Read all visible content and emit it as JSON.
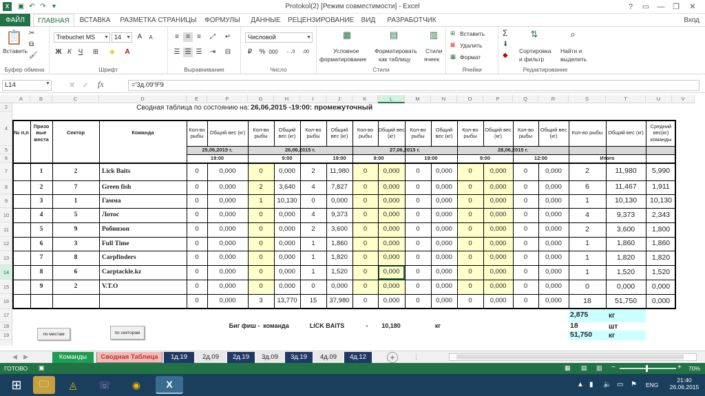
{
  "window": {
    "title": "Protokol(2) [Режим совместимости] - Excel",
    "user": "Вход"
  },
  "tabs": [
    "ФАЙЛ",
    "ГЛАВНАЯ",
    "ВСТАВКА",
    "РАЗМЕТКА СТРАНИЦЫ",
    "ФОРМУЛЫ",
    "ДАННЫЕ",
    "РЕЦЕНЗИРОВАНИЕ",
    "ВИД",
    "РАЗРАБОТЧИК"
  ],
  "ribbon": {
    "clipboard": {
      "label": "Буфер обмена",
      "paste": "Вставить"
    },
    "font": {
      "label": "Шрифт",
      "name": "Trebuchet MS",
      "size": "14",
      "bold": "Ж",
      "italic": "К",
      "underline": "Ч",
      "grow": "A",
      "shrink": "A"
    },
    "alignment": {
      "label": "Выравнивание"
    },
    "number": {
      "label": "Число",
      "format": "Числовой",
      "percent": "%",
      "thousands": "000",
      "inc_dec": "←,0",
      "dec_dec": ",00"
    },
    "styles": {
      "label": "Стили",
      "conditional": [
        "Условное",
        "форматирование"
      ],
      "table": [
        "Форматировать",
        "как таблицу"
      ],
      "cell": [
        "Стили",
        "ячеек"
      ]
    },
    "cells": {
      "label": "Ячейки",
      "insert": "Вставить",
      "delete": "Удалить",
      "format": "Формат"
    },
    "editing": {
      "label": "Редактирование",
      "sort": [
        "Сортировка",
        "и фильтр"
      ],
      "find": [
        "Найти и",
        "выделить"
      ]
    }
  },
  "formula_bar": {
    "name_box": "L14",
    "formula": "='3д.09'!F9"
  },
  "columns": [
    "A",
    "B",
    "C",
    "D",
    "E",
    "F",
    "G",
    "H",
    "I",
    "J",
    "K",
    "L",
    "M",
    "N",
    "O",
    "P",
    "Q",
    "R",
    "S",
    "T",
    "U",
    "V"
  ],
  "rows": [
    "2",
    "4",
    "5",
    "6",
    "7",
    "8",
    "9",
    "10",
    "11",
    "12",
    "13",
    "14",
    "15",
    "16",
    "17",
    "18",
    "19"
  ],
  "sheet": {
    "title_label": "Сводная таблица по состоянию на:",
    "title_value": "26,06,2015 -19:00: промежуточный",
    "hdr_num": "№ п,п",
    "hdr_place": "Призо вые места",
    "hdr_sector": "Сектор",
    "hdr_team": "Команда",
    "hdr_qty": "Кол-во рыбы",
    "hdr_weight": "Общий вес (кг)",
    "hdr_qty_total": "Кол-во рыбы",
    "hdr_weight_total": "Общий вес (кг)",
    "hdr_avg": "Средний вес(кг) команды",
    "dates": [
      "25,06,2015 г.",
      "26,06,2015 г.",
      "27,06,2015 г.",
      "28,06,2015 г."
    ],
    "times": [
      "19:00",
      "9:00",
      "19:00",
      "9:00",
      "19:00",
      "9:00",
      "12:00"
    ],
    "total_label": "Итого",
    "teams": [
      {
        "n": "1",
        "p": "2",
        "name": "Lick Baits",
        "v": [
          "0",
          "0,000",
          "0",
          "0,000",
          "2",
          "11,980",
          "0",
          "0,000",
          "0",
          "0,000",
          "0",
          "0,000",
          "0",
          "0,000"
        ],
        "tq": "2",
        "tw": "11,980",
        "avg": "5,990"
      },
      {
        "n": "2",
        "p": "7",
        "name": "Green fish",
        "v": [
          "0",
          "0,000",
          "2",
          "3,640",
          "4",
          "7,827",
          "0",
          "0,000",
          "0",
          "0,000",
          "0",
          "0,000",
          "0",
          "0,000"
        ],
        "tq": "6",
        "tw": "11,467",
        "avg": "1,911"
      },
      {
        "n": "3",
        "p": "1",
        "name": "Гамма",
        "v": [
          "0",
          "0,000",
          "1",
          "10,130",
          "0",
          "0,000",
          "0",
          "0,000",
          "0",
          "0,000",
          "0",
          "0,000",
          "0",
          "0,000"
        ],
        "tq": "1",
        "tw": "10,130",
        "avg": "10,130"
      },
      {
        "n": "4",
        "p": "5",
        "name": "Лотос",
        "v": [
          "0",
          "0,000",
          "0",
          "0,000",
          "4",
          "9,373",
          "0",
          "0,000",
          "0",
          "0,000",
          "0",
          "0,000",
          "0",
          "0,000"
        ],
        "tq": "4",
        "tw": "9,373",
        "avg": "2,343"
      },
      {
        "n": "5",
        "p": "9",
        "name": "Робинзон",
        "v": [
          "0",
          "0,000",
          "0",
          "0,000",
          "2",
          "3,600",
          "0",
          "0,000",
          "0",
          "0,000",
          "0",
          "0,000",
          "0",
          "0,000"
        ],
        "tq": "2",
        "tw": "3,600",
        "avg": "1,800"
      },
      {
        "n": "6",
        "p": "3",
        "name": "Full Time",
        "v": [
          "0",
          "0,000",
          "0",
          "0,000",
          "1",
          "1,860",
          "0",
          "0,000",
          "0",
          "0,000",
          "0",
          "0,000",
          "0",
          "0,000"
        ],
        "tq": "1",
        "tw": "1,860",
        "avg": "1,860"
      },
      {
        "n": "7",
        "p": "8",
        "name": "Carpfinders",
        "v": [
          "0",
          "0,000",
          "0",
          "0,000",
          "1",
          "1,820",
          "0",
          "0,000",
          "0",
          "0,000",
          "0",
          "0,000",
          "0",
          "0,000"
        ],
        "tq": "1",
        "tw": "1,820",
        "avg": "1,820"
      },
      {
        "n": "8",
        "p": "6",
        "name": "Carptackle.kz",
        "v": [
          "0",
          "0,000",
          "0",
          "0,000",
          "1",
          "1,520",
          "0",
          "0,000",
          "0",
          "0,000",
          "0",
          "0,000",
          "0",
          "0,000"
        ],
        "tq": "1",
        "tw": "1,520",
        "avg": "1,520"
      },
      {
        "n": "9",
        "p": "2",
        "name": "V.T.O",
        "v": [
          "0",
          "0,000",
          "0",
          "0,000",
          "0",
          "0,000",
          "0",
          "0,000",
          "0",
          "0,000",
          "0",
          "0,000",
          "0",
          "0,000"
        ],
        "tq": "0",
        "tw": "0,000",
        "avg": "0,000"
      }
    ],
    "totals": {
      "v": [
        "0",
        "0,000",
        "3",
        "13,770",
        "15",
        "37,980",
        "0",
        "0,000",
        "0",
        "0,000",
        "0",
        "0,000",
        "0",
        "0,000"
      ],
      "tq": "18",
      "tw": "51,750",
      "avg": "0,000"
    },
    "bigfish": {
      "label": "Биг фиш -",
      "team_label": "команда",
      "team": "LICK BAITS",
      "dash": "-",
      "value": "10,180",
      "unit": "кг"
    },
    "summary": [
      {
        "value": "2,875",
        "unit": "кг"
      },
      {
        "value": "18",
        "unit": "шт"
      },
      {
        "value": "51,750",
        "unit": "кг"
      }
    ],
    "btn_places": "по местам",
    "btn_sectors": "по секторам"
  },
  "sheet_tabs": [
    {
      "label": "Команды",
      "bg": "#1e9e52"
    },
    {
      "label": "Сводная Таблица",
      "bg": "#f4b9b9",
      "fg": "#c0312b"
    },
    {
      "label": "1д.19",
      "bg": "#1f3864"
    },
    {
      "label": "2д.09",
      "bg": "#e8e8e8",
      "fg": "#222"
    },
    {
      "label": "2д.19",
      "bg": "#1f3864"
    },
    {
      "label": "3д.09",
      "bg": "#e8e8e8",
      "fg": "#222"
    },
    {
      "label": "3д.19",
      "bg": "#1f3864"
    },
    {
      "label": "4д.09",
      "bg": "#e8e8e8",
      "fg": "#222"
    },
    {
      "label": "4д.12",
      "bg": "#1f3864"
    }
  ],
  "status": {
    "ready": "ГОТОВО",
    "zoom": "70%"
  },
  "taskbar": {
    "lang": "ENG",
    "time": "21:40",
    "date": "26.06.2015"
  },
  "colors": {
    "accent": "#217346",
    "highlight": "#ffffcc",
    "cyan": "#ccffff",
    "taskbar": "#1a3f5c"
  }
}
